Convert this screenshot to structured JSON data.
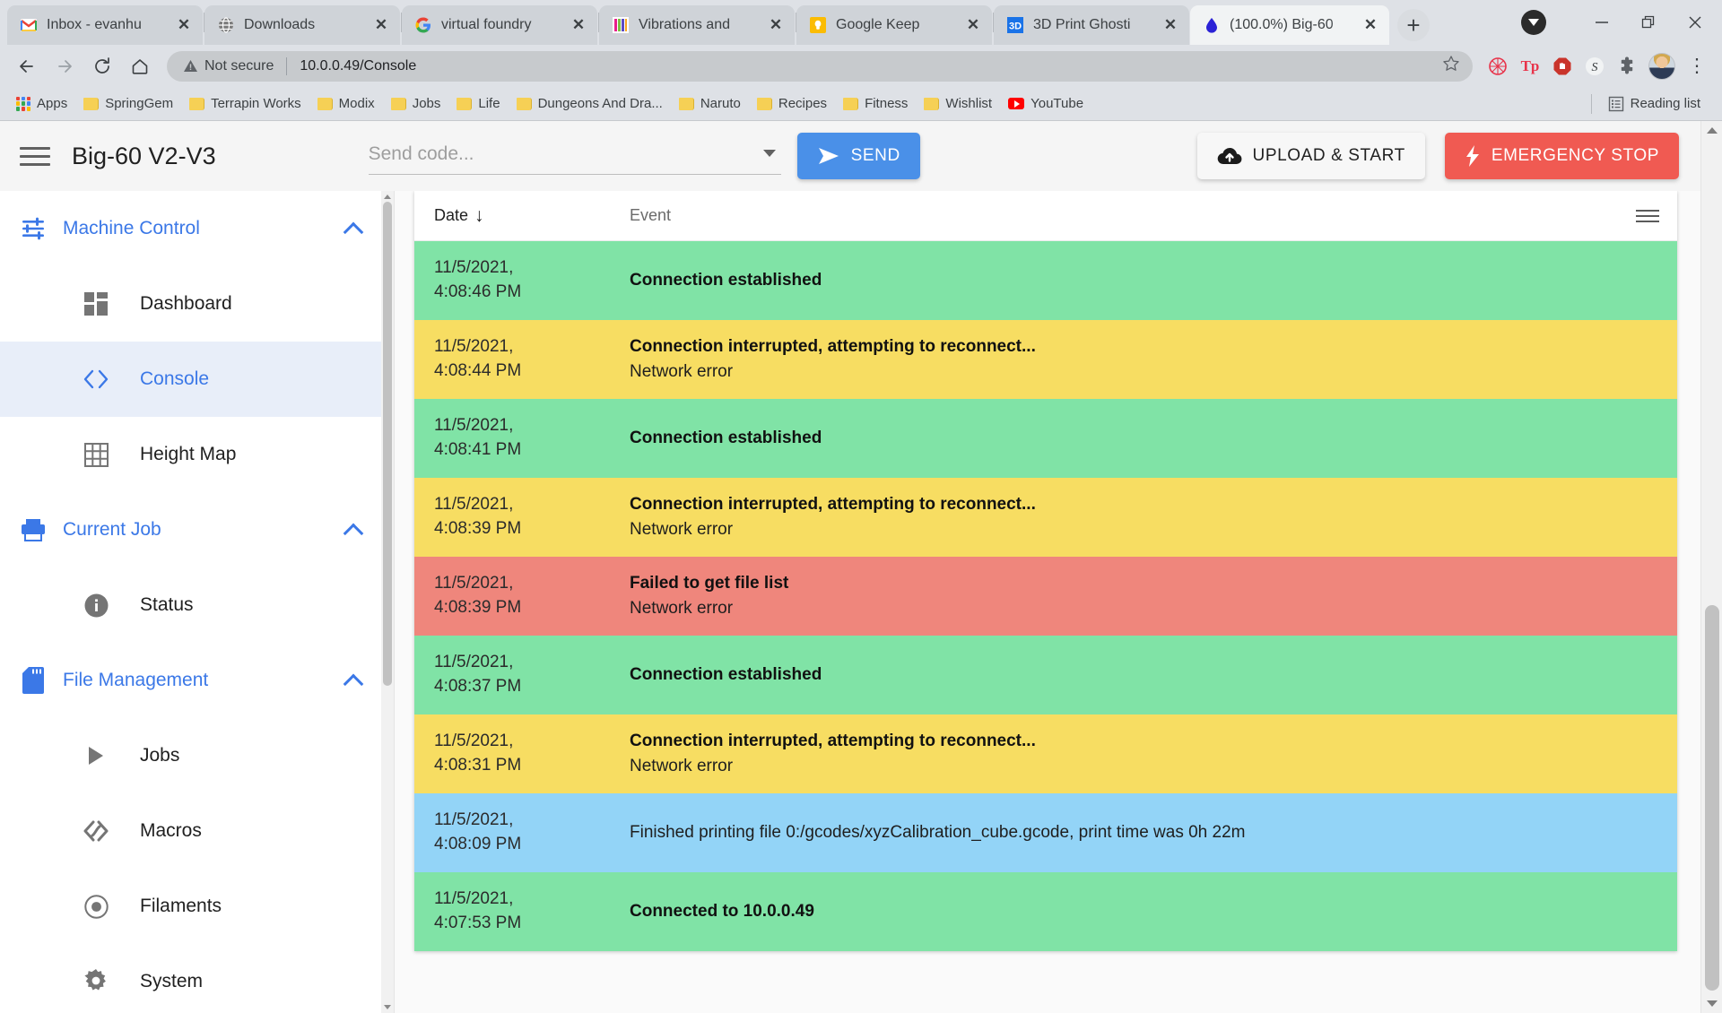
{
  "browser": {
    "tabs": [
      {
        "title": "Inbox - evanhu",
        "icon": "gmail-icon",
        "active": false
      },
      {
        "title": "Downloads",
        "icon": "globe-icon",
        "active": false
      },
      {
        "title": "virtual foundry",
        "icon": "google-icon",
        "active": false
      },
      {
        "title": "Vibrations and",
        "icon": "colorbars-icon",
        "active": false
      },
      {
        "title": "Google Keep",
        "icon": "keep-bulb-icon",
        "active": false
      },
      {
        "title": "3D Print Ghosti",
        "icon": "3d-icon",
        "active": false
      },
      {
        "title": "(100.0%) Big-60",
        "icon": "droplet-icon",
        "active": true
      }
    ],
    "new_tab_label": "+",
    "window_controls": {
      "minimize": "—",
      "maximize": "❐",
      "close": "✕"
    },
    "omnibox": {
      "security_label": "Not secure",
      "url": "10.0.0.49/Console",
      "star_tooltip": "Bookmark this tab"
    },
    "nav": {
      "back": "←",
      "forward": "→",
      "reload": "↻",
      "home": "⌂"
    },
    "extensions": [
      {
        "name": "raspberry-icon",
        "glyph": "⌘",
        "color": "#e8334a"
      },
      {
        "name": "tp-extension-icon",
        "glyph": "Tp",
        "color": "#e8334a"
      },
      {
        "name": "adblock-icon",
        "glyph": "✋",
        "color": "#c9342b"
      },
      {
        "name": "s-extension-icon",
        "glyph": "S",
        "color": "#3c4043"
      },
      {
        "name": "puzzle-extensions-icon",
        "glyph": "🧩",
        "color": "#5f6368"
      }
    ],
    "menu_glyph": "⋮",
    "bookmarks": [
      {
        "label": "Apps",
        "icon": "apps-grid-icon"
      },
      {
        "label": "SpringGem",
        "icon": "folder-icon"
      },
      {
        "label": "Terrapin Works",
        "icon": "folder-icon"
      },
      {
        "label": "Modix",
        "icon": "folder-icon"
      },
      {
        "label": "Jobs",
        "icon": "folder-icon"
      },
      {
        "label": "Life",
        "icon": "folder-icon"
      },
      {
        "label": "Dungeons And Dra...",
        "icon": "folder-icon"
      },
      {
        "label": "Naruto",
        "icon": "folder-icon"
      },
      {
        "label": "Recipes",
        "icon": "folder-icon"
      },
      {
        "label": "Fitness",
        "icon": "folder-icon"
      },
      {
        "label": "Wishlist",
        "icon": "folder-icon"
      },
      {
        "label": "YouTube",
        "icon": "youtube-icon"
      }
    ],
    "reading_list": "Reading list"
  },
  "app": {
    "title": "Big-60 V2-V3",
    "code_input": {
      "value": "",
      "placeholder": "Send code..."
    },
    "send_label": "SEND",
    "upload_label": "UPLOAD & START",
    "emergency_label": "EMERGENCY STOP"
  },
  "sidebar": {
    "groups": [
      {
        "label": "Machine Control",
        "icon": "sliders-icon",
        "expanded": true,
        "items": [
          {
            "label": "Dashboard",
            "icon": "dashboard-grid-icon",
            "active": false
          },
          {
            "label": "Console",
            "icon": "code-brackets-icon",
            "active": true
          },
          {
            "label": "Height Map",
            "icon": "grid-table-icon",
            "active": false
          }
        ]
      },
      {
        "label": "Current Job",
        "icon": "printer-icon",
        "expanded": true,
        "items": [
          {
            "label": "Status",
            "icon": "info-icon",
            "active": false
          }
        ]
      },
      {
        "label": "File Management",
        "icon": "sd-card-icon",
        "expanded": true,
        "items": [
          {
            "label": "Jobs",
            "icon": "play-triangle-icon",
            "active": false
          },
          {
            "label": "Macros",
            "icon": "macros-icon",
            "active": false
          },
          {
            "label": "Filaments",
            "icon": "filament-spool-icon",
            "active": false
          },
          {
            "label": "System",
            "icon": "gear-icon",
            "active": false
          }
        ]
      }
    ]
  },
  "log": {
    "columns": {
      "date": "Date",
      "sort_arrow": "↓",
      "event": "Event"
    },
    "rows": [
      {
        "date_line1": "11/5/2021,",
        "date_line2": "4:08:46 PM",
        "title": "Connection established",
        "detail": "",
        "type": "success",
        "bold": true
      },
      {
        "date_line1": "11/5/2021,",
        "date_line2": "4:08:44 PM",
        "title": "Connection interrupted, attempting to reconnect...",
        "detail": "Network error",
        "type": "warning",
        "bold": true
      },
      {
        "date_line1": "11/5/2021,",
        "date_line2": "4:08:41 PM",
        "title": "Connection established",
        "detail": "",
        "type": "success",
        "bold": true
      },
      {
        "date_line1": "11/5/2021,",
        "date_line2": "4:08:39 PM",
        "title": "Connection interrupted, attempting to reconnect...",
        "detail": "Network error",
        "type": "warning",
        "bold": true
      },
      {
        "date_line1": "11/5/2021,",
        "date_line2": "4:08:39 PM",
        "title": "Failed to get file list",
        "detail": "Network error",
        "type": "error",
        "bold": true
      },
      {
        "date_line1": "11/5/2021,",
        "date_line2": "4:08:37 PM",
        "title": "Connection established",
        "detail": "",
        "type": "success",
        "bold": true
      },
      {
        "date_line1": "11/5/2021,",
        "date_line2": "4:08:31 PM",
        "title": "Connection interrupted, attempting to reconnect...",
        "detail": "Network error",
        "type": "warning",
        "bold": true
      },
      {
        "date_line1": "11/5/2021,",
        "date_line2": "4:08:09 PM",
        "title": "Finished printing file 0:/gcodes/xyzCalibration_cube.gcode, print time was 0h 22m",
        "detail": "",
        "type": "info",
        "bold": false
      },
      {
        "date_line1": "11/5/2021,",
        "date_line2": "4:07:53 PM",
        "title": "Connected to 10.0.0.49",
        "detail": "",
        "type": "success",
        "bold": true
      }
    ]
  },
  "colors": {
    "success": "#80e3a6",
    "warning": "#f7dd62",
    "error": "#ef867c",
    "info": "#93d4f7",
    "accent_blue": "#3b78e7",
    "send_blue": "#4a90e8",
    "stop_red": "#f05a52"
  }
}
